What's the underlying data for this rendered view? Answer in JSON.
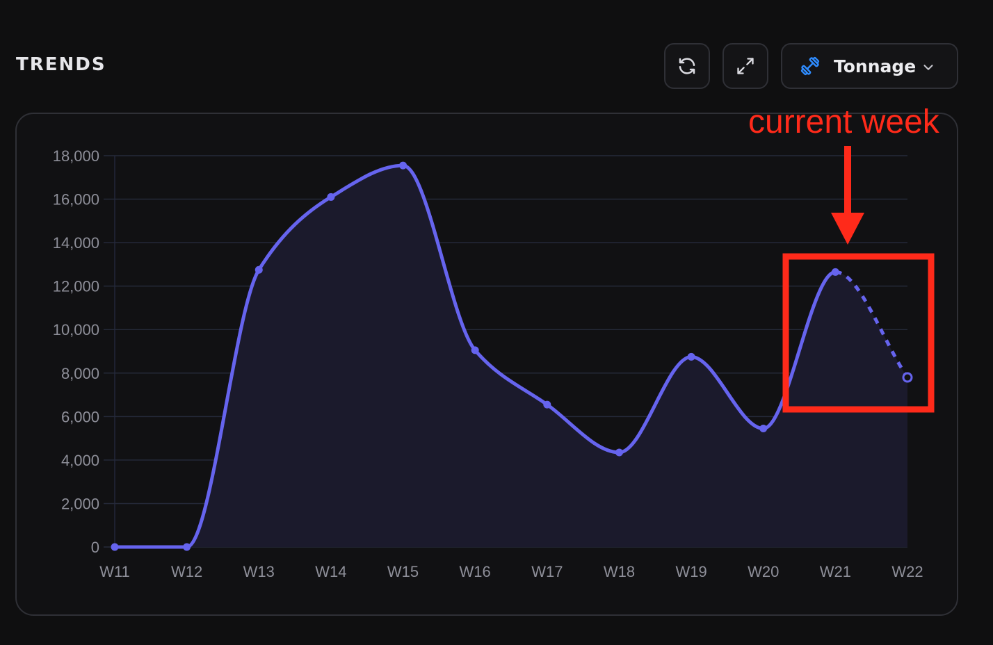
{
  "header": {
    "title": "TRENDS"
  },
  "toolbar": {
    "refresh_icon": "refresh-icon",
    "expand_icon": "expand-icon",
    "metric_icon": "dumbbell-icon",
    "metric_label": "Tonnage",
    "dropdown_icon": "chevron-down-icon"
  },
  "annotation": {
    "text": "current week",
    "color": "#ff2a1a"
  },
  "colors": {
    "line": "#6664ee",
    "area": "#1b1a2c",
    "grid": "#252a3a",
    "accent_icon": "#2f8cff"
  },
  "chart_data": {
    "type": "area",
    "title": "",
    "xlabel": "",
    "ylabel": "",
    "categories": [
      "W11",
      "W12",
      "W13",
      "W14",
      "W15",
      "W16",
      "W17",
      "W18",
      "W19",
      "W20",
      "W21",
      "W22"
    ],
    "series": [
      {
        "values": [
          0,
          0,
          12750,
          16100,
          17550,
          9050,
          6550,
          4350,
          8750,
          5450,
          12650,
          7800
        ],
        "projected_from_index": 10
      }
    ],
    "ylim": [
      0,
      18000
    ],
    "yticks": [
      0,
      2000,
      4000,
      6000,
      8000,
      10000,
      12000,
      14000,
      16000,
      18000
    ],
    "ytick_labels": [
      "0",
      "2,000",
      "4,000",
      "6,000",
      "8,000",
      "10,000",
      "12,000",
      "14,000",
      "16,000",
      "18,000"
    ],
    "grid": true,
    "legend": "none"
  }
}
